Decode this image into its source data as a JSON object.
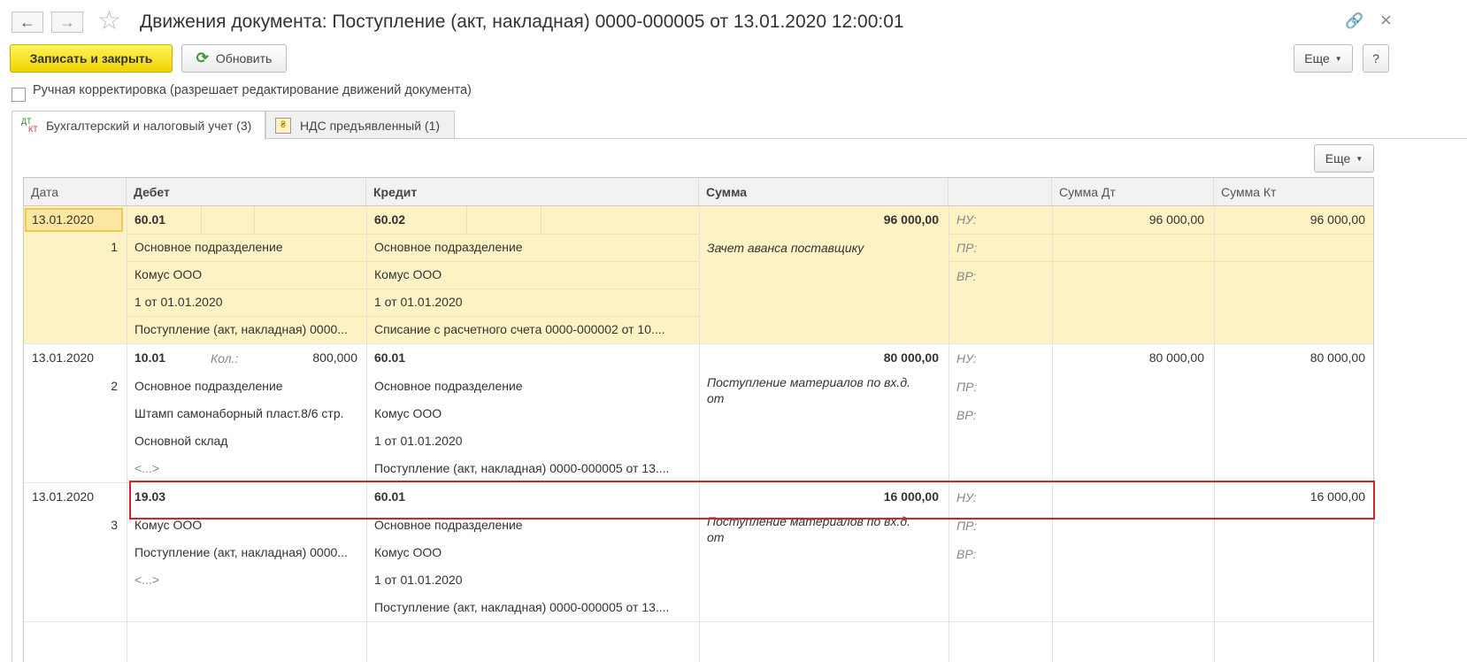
{
  "window": {
    "title": "Движения документа: Поступление (акт, накладная) 0000-000005 от 13.01.2020 12:00:01",
    "back_glyph": "←",
    "forward_glyph": "→",
    "star_glyph": "☆",
    "link_glyph": "🔗",
    "close_glyph": "×"
  },
  "toolbar": {
    "save_close": "Записать и закрыть",
    "refresh": "Обновить",
    "refresh_glyph": "⟳",
    "more": "Еще",
    "help": "?"
  },
  "manual_edit": {
    "label": "Ручная корректировка (разрешает редактирование движений документа)",
    "checked": false
  },
  "tabs": [
    {
      "label": "Бухгалтерский и налоговый учет (3)",
      "icon": "дт-кт-icon",
      "icon_top": "ДТ",
      "icon_bottom": "КТ",
      "active": true
    },
    {
      "label": "НДС предъявленный (1)",
      "icon": "coin-register-icon",
      "icon_glyph": "₴",
      "active": false
    }
  ],
  "grid": {
    "more": "Еще",
    "columns": [
      "Дата",
      "Дебет",
      "Кредит",
      "Сумма",
      "",
      "Сумма Дт",
      "Сумма Кт"
    ],
    "rows": [
      {
        "date": "13.01.2020",
        "num": "1",
        "debit_account": "60.01",
        "debit_qty_label": "",
        "debit_qty": "",
        "debit_sub": [
          "Основное подразделение",
          "Комус ООО",
          "1 от 01.01.2020",
          "Поступление (акт, накладная) 0000..."
        ],
        "credit_account": "60.02",
        "credit_sub": [
          "Основное подразделение",
          "Комус ООО",
          "1 от 01.01.2020",
          "Списание с расчетного счета 0000-000002 от 10...."
        ],
        "sum": "96 000,00",
        "comment": "Зачет аванса поставщику",
        "tax_labels": [
          "НУ:",
          "ПР:",
          "ВР:"
        ],
        "sum_dt": "96 000,00",
        "sum_kt": "96 000,00"
      },
      {
        "date": "13.01.2020",
        "num": "2",
        "debit_account": "10.01",
        "debit_qty_label": "Кол.:",
        "debit_qty": "800,000",
        "debit_sub": [
          "Основное подразделение",
          "Штамп самонаборный пласт.8/6 стр.",
          "Основной склад",
          "<...>"
        ],
        "credit_account": "60.01",
        "credit_sub": [
          "Основное подразделение",
          "Комус ООО",
          "1 от 01.01.2020",
          "Поступление (акт, накладная) 0000-000005 от 13...."
        ],
        "sum": "80 000,00",
        "comment_line1": "Поступление материалов по вх.д.",
        "comment_line2": "от",
        "tax_labels": [
          "НУ:",
          "ПР:",
          "ВР:"
        ],
        "sum_dt": "80 000,00",
        "sum_kt": "80 000,00"
      },
      {
        "date": "13.01.2020",
        "num": "3",
        "debit_account": "19.03",
        "debit_sub": [
          "Комус ООО",
          "Поступление (акт, накладная) 0000...",
          "<...>"
        ],
        "credit_account": "60.01",
        "credit_sub": [
          "Основное подразделение",
          "Комус ООО",
          "1 от 01.01.2020",
          "Поступление (акт, накладная) 0000-000005 от 13...."
        ],
        "sum": "16 000,00",
        "comment_line1": "Поступление материалов по вх.д.",
        "comment_line2": "от",
        "tax_labels": [
          "НУ:",
          "ПР:",
          "ВР:"
        ],
        "sum_dt": "",
        "sum_kt": "16 000,00"
      }
    ]
  },
  "colors": {
    "selected_row": "#fdf2c4",
    "primary_button": "#f5d90a",
    "highlight_border": "#d3242c",
    "tax_label": "#8a8a6a"
  }
}
